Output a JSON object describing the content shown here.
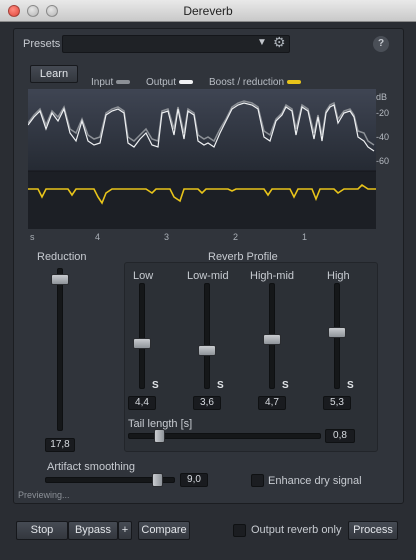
{
  "window": {
    "title": "Dereverb"
  },
  "presets": {
    "label": "Presets",
    "value": "",
    "dropdown_icon": "▼",
    "gear_icon": "gear-icon",
    "help_label": "?"
  },
  "learn": {
    "label": "Learn"
  },
  "legend": [
    {
      "label": "Input",
      "color": "#8c9096"
    },
    {
      "label": "Output",
      "color": "#f1f2f4"
    },
    {
      "label": "Boost / reduction",
      "color": "#e8c41a"
    }
  ],
  "graph": {
    "db_labels": [
      "dB",
      "-20",
      "-40",
      "-60"
    ],
    "time_ticks": [
      "s",
      "4",
      "3",
      "2",
      "1"
    ]
  },
  "reduction": {
    "label": "Reduction",
    "value": "17,8",
    "level": 0.95
  },
  "reverb_profile": {
    "title": "Reverb Profile",
    "bands": [
      {
        "label": "Low",
        "value": "4,4",
        "solo": "S",
        "level": 0.6
      },
      {
        "label": "Low-mid",
        "value": "3,6",
        "solo": "S",
        "level": 0.52
      },
      {
        "label": "High-mid",
        "value": "4,7",
        "solo": "S",
        "level": 0.64
      },
      {
        "label": "High",
        "value": "5,3",
        "solo": "S",
        "level": 0.71
      }
    ],
    "tail": {
      "label": "Tail length [s]",
      "value": "0,8",
      "level": 0.15
    }
  },
  "artifact": {
    "label": "Artifact smoothing",
    "value": "9,0",
    "level": 0.9
  },
  "enhance": {
    "label": "Enhance dry signal",
    "checked": false
  },
  "status": {
    "text": "Previewing..."
  },
  "bottom": {
    "stop": "Stop",
    "bypass": "Bypass",
    "plus": "+",
    "compare": "Compare",
    "output_reverb_only": "Output reverb only",
    "process": "Process"
  }
}
